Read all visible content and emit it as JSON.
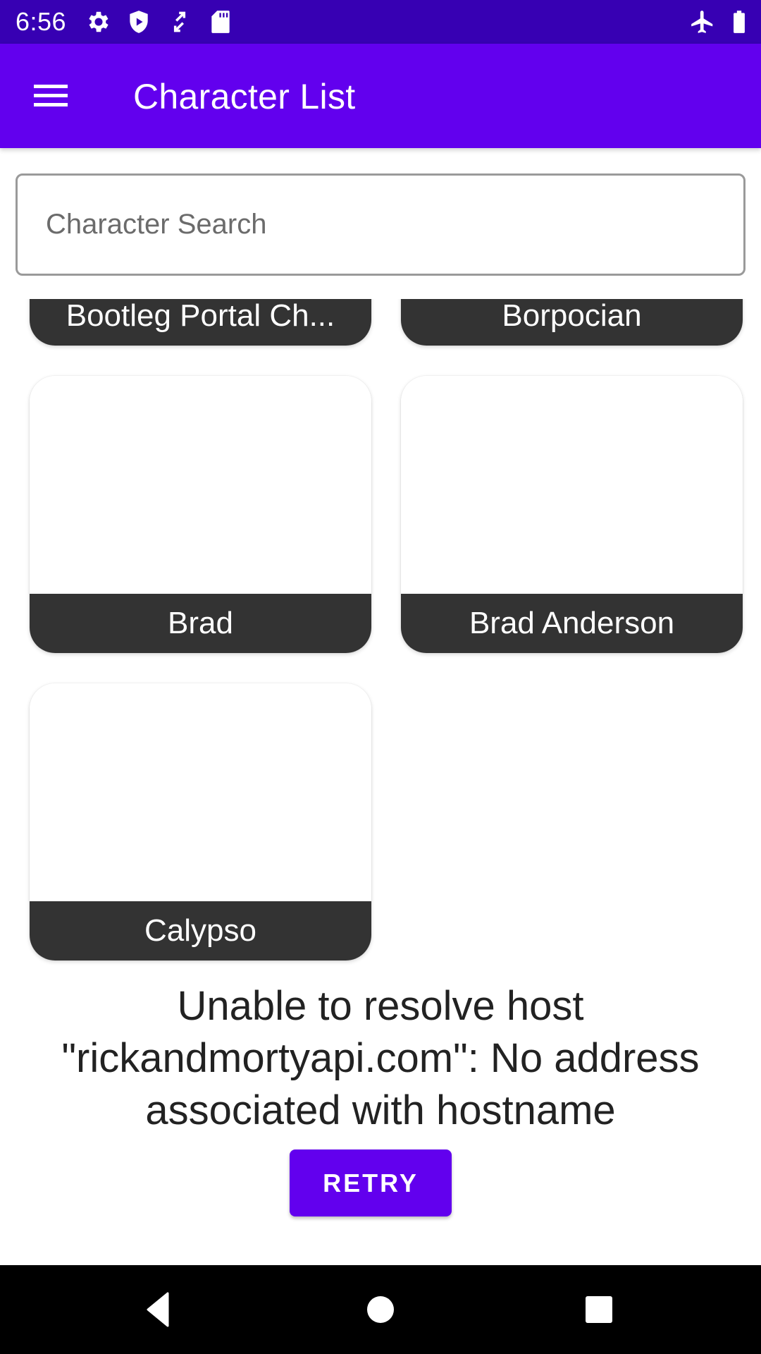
{
  "status_bar": {
    "time": "6:56",
    "left_icons": [
      "gear-icon",
      "shield-play-icon",
      "data-transfer-icon",
      "sd-card-icon"
    ],
    "right_icons": [
      "airplane-mode-icon",
      "battery-icon"
    ]
  },
  "app_bar": {
    "title": "Character List",
    "menu_icon": "hamburger-menu-icon"
  },
  "search": {
    "placeholder": "Character Search",
    "value": ""
  },
  "characters": [
    {
      "name": "Bootleg Portal Chemist",
      "display": "Bootleg Portal Ch..."
    },
    {
      "name": "Borpocian",
      "display": "Borpocian"
    },
    {
      "name": "Brad",
      "display": "Brad"
    },
    {
      "name": "Brad Anderson",
      "display": "Brad Anderson"
    },
    {
      "name": "Calypso",
      "display": "Calypso"
    }
  ],
  "error": {
    "message": "Unable to resolve host \"rickandmortyapi.com\": No address associated with hostname",
    "retry_label": "RETRY"
  },
  "nav_bar": {
    "buttons": [
      "back-icon",
      "home-icon",
      "recents-icon"
    ]
  },
  "colors": {
    "status_bar": "#3700B3",
    "primary": "#6200EE",
    "card_label_bg": "#333333"
  }
}
